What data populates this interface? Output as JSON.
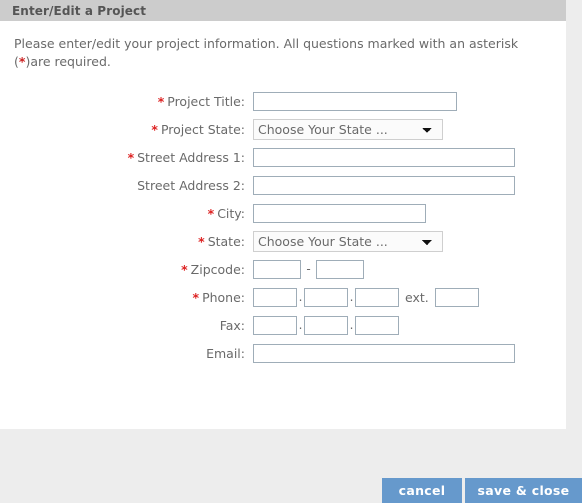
{
  "panel": {
    "header_title": "Enter/Edit a Project",
    "intro_before": "Please enter/edit your project information.  All questions marked with an asterisk (",
    "intro_asterisk": "*",
    "intro_after": ")are required."
  },
  "form": {
    "rows": [
      {
        "label": "Project Title:",
        "required": true,
        "required_marker": "*",
        "type": "text",
        "value": "",
        "placeholder": ""
      },
      {
        "label": "Project State:",
        "required": true,
        "required_marker": "*",
        "type": "select",
        "selected": "Choose Your State ...",
        "options": [
          "Choose Your State ..."
        ]
      },
      {
        "label": "Street Address 1:",
        "required": true,
        "required_marker": "*",
        "type": "text",
        "value": "",
        "placeholder": ""
      },
      {
        "label": "Street Address 2:",
        "required": false,
        "required_marker": "",
        "type": "text",
        "value": "",
        "placeholder": ""
      },
      {
        "label": "City:",
        "required": true,
        "required_marker": "*",
        "type": "text",
        "value": "",
        "placeholder": ""
      },
      {
        "label": "State:",
        "required": true,
        "required_marker": "*",
        "type": "select",
        "selected": "Choose Your State ...",
        "options": [
          "Choose Your State ..."
        ]
      },
      {
        "label": "Zipcode:",
        "required": true,
        "required_marker": "*",
        "type": "zipcode",
        "zip5": "",
        "separator": "-",
        "zip4": ""
      },
      {
        "label": "Phone:",
        "required": true,
        "required_marker": "*",
        "type": "phone",
        "part1": "",
        "part2": "",
        "part3": "",
        "separator": ".",
        "ext_label": "ext.",
        "ext": ""
      },
      {
        "label": "Fax:",
        "required": false,
        "required_marker": "",
        "type": "fax",
        "part1": "",
        "part2": "",
        "part3": "",
        "separator": "."
      },
      {
        "label": "Email:",
        "required": false,
        "required_marker": "",
        "type": "text",
        "value": "",
        "placeholder": ""
      }
    ]
  },
  "footer": {
    "cancel_label": "cancel",
    "save_label": "save & close"
  },
  "colors": {
    "header_bar": "#cccccc",
    "panel_background": "#ffffff",
    "page_background": "#ededed",
    "button_blue": "#6699cc",
    "required_red": "#dd2222",
    "text_gray": "#6a6a6a",
    "input_border": "#9fadb8"
  }
}
